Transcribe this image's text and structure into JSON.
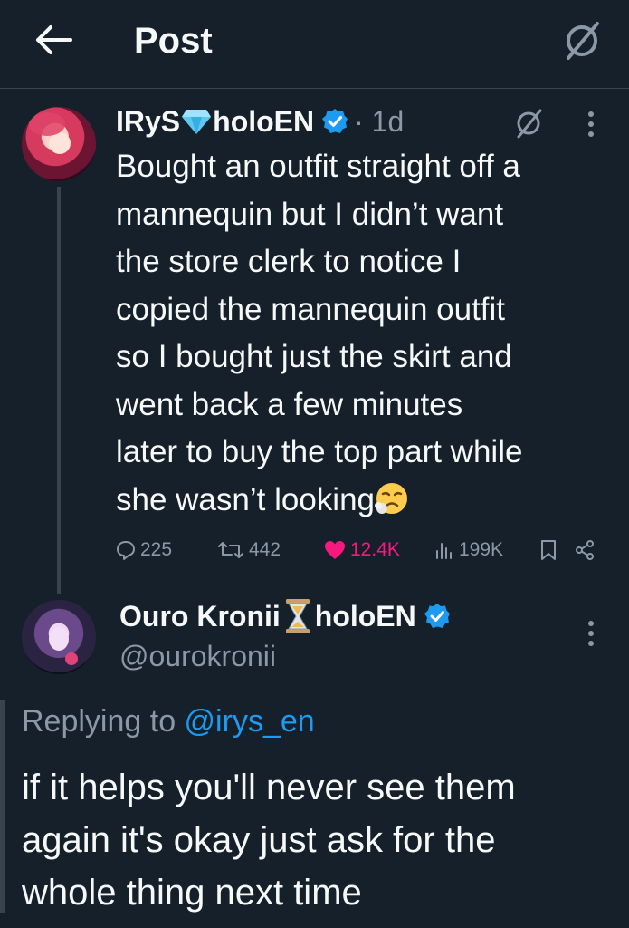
{
  "header": {
    "title": "Post",
    "back_icon": "arrow-left-icon",
    "grok_icon": "grok-icon"
  },
  "tweet": {
    "author_name_part1": "IRyS",
    "author_name_part2": "holoEN",
    "name_emoji": "gem-icon",
    "verified_icon": "verified-badge-icon",
    "time": "· 1d",
    "text": "Bought an outfit straight off a\nmannequin but I didn’t want\nthe store clerk to notice I\ncopied the mannequin outfit\nso I bought just the skirt and\nwent back a few minutes\nlater to buy the top part while\nshe wasn’t looking",
    "trailing_emoji": "face-exhaling-icon",
    "stats": {
      "replies": "225",
      "reposts": "442",
      "likes": "12.4K",
      "views": "199K"
    }
  },
  "reply": {
    "author_name_part1": "Ouro Kronii",
    "author_name_part2": "holoEN",
    "name_emoji": "hourglass-icon",
    "verified_icon": "verified-badge-icon",
    "handle": "@ourokronii",
    "replying_prefix": "Replying to ",
    "replying_mention": "@irys_en",
    "text": "if it helps you'll never see them\nagain it's okay just ask for the\nwhole thing next time"
  },
  "colors": {
    "background": "#15202b",
    "text": "#f7f9f9",
    "muted": "#8b98a5",
    "accent": "#1d9bf0",
    "like": "#f91880"
  }
}
